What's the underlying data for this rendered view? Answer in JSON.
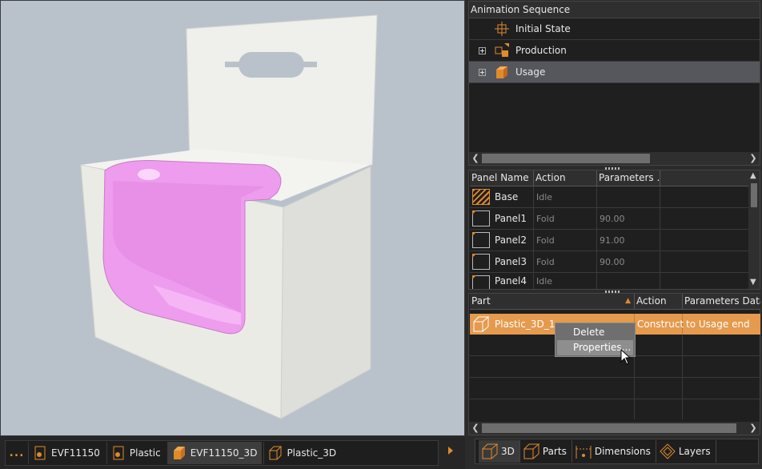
{
  "document_tabs": {
    "overflow": "...",
    "items": [
      {
        "label": "EVF11150",
        "icon": "panel-doc-icon"
      },
      {
        "label": "Plastic",
        "icon": "panel-doc-icon"
      },
      {
        "label": "EVF11150_3D",
        "icon": "box-3d-icon"
      },
      {
        "label": "Plastic_3D",
        "icon": "box-3d-icon"
      }
    ]
  },
  "animation_sequence": {
    "title": "Animation Sequence",
    "items": [
      {
        "label": "Initial State",
        "icon": "initial-state-icon"
      },
      {
        "label": "Production",
        "icon": "production-icon"
      },
      {
        "label": "Usage",
        "icon": "usage-icon",
        "selected": true
      }
    ]
  },
  "panels_table": {
    "columns": [
      "Panel Name",
      "Action",
      "Parameters ..."
    ],
    "rows": [
      {
        "name": "Base",
        "action": "Idle",
        "param": ""
      },
      {
        "name": "Panel1",
        "action": "Fold",
        "param": "90.00"
      },
      {
        "name": "Panel2",
        "action": "Fold",
        "param": "91.00"
      },
      {
        "name": "Panel3",
        "action": "Fold",
        "param": "90.00"
      },
      {
        "name": "Panel4",
        "action": "Idle",
        "param": ""
      }
    ]
  },
  "parts_table": {
    "columns": [
      "Part",
      "Action",
      "Parameters Data"
    ],
    "rows": [
      {
        "part": "Plastic_3D_1",
        "action": "Construct",
        "params": "to Usage end"
      }
    ]
  },
  "context_menu": {
    "items": [
      "Delete",
      "Properties..."
    ]
  },
  "view_tabs": {
    "items": [
      {
        "label": "3D",
        "icon": "cube-3d-icon"
      },
      {
        "label": "Parts",
        "icon": "parts-icon"
      },
      {
        "label": "Dimensions",
        "icon": "dimensions-icon"
      },
      {
        "label": "Layers",
        "icon": "layers-icon"
      }
    ]
  },
  "colors": {
    "accent": "#e08a2c",
    "selection": "#e59a4d",
    "viewport_bg": "#b9c2cb"
  }
}
